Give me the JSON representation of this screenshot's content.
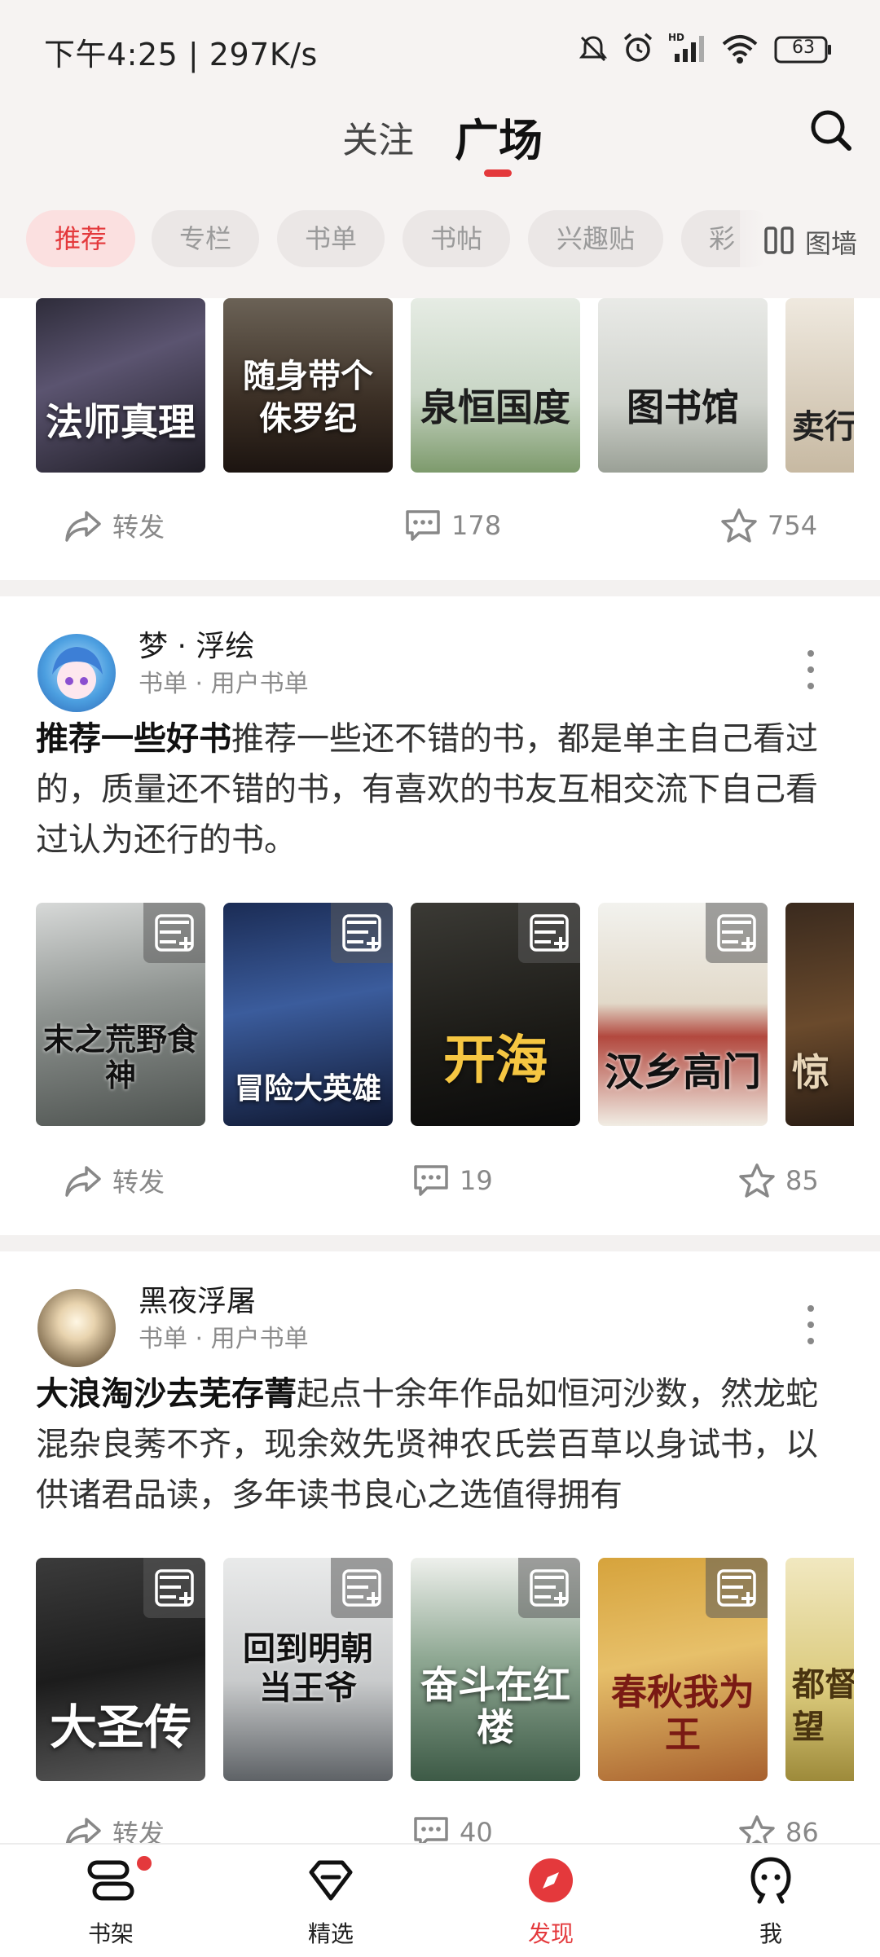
{
  "status_bar": {
    "time_speed": "下午4:25 | 297K/s",
    "battery": "63"
  },
  "header": {
    "tab_follow": "关注",
    "tab_square": "广场"
  },
  "chips": {
    "items": [
      "推荐",
      "专栏",
      "书单",
      "书帖",
      "兴趣贴",
      "彩"
    ],
    "wall_label": "图墙"
  },
  "post1": {
    "covers": [
      "法师真理",
      "随身带个侏罗纪",
      "泉恒国度",
      "图书馆",
      "卖行"
    ],
    "repost": "转发",
    "comments": "178",
    "likes": "754"
  },
  "post2": {
    "author": "梦 · 浮绘",
    "meta": "书单 · 用户书单",
    "title": "推荐一些好书",
    "body": "推荐一些还不错的书，都是单主自己看过的，质量还不错的书，有喜欢的书友互相交流下自己看过认为还行的书。",
    "covers": [
      "末之荒野食神",
      "冒险大英雄",
      "开海",
      "汉乡高门",
      "惊"
    ],
    "repost": "转发",
    "comments": "19",
    "likes": "85"
  },
  "post3": {
    "author": "黑夜浮屠",
    "meta": "书单 · 用户书单",
    "title": "大浪淘沙去芜存菁",
    "body": "起点十余年作品如恒河沙数，然龙蛇混杂良莠不齐，现余效先贤神农氏尝百草以身试书，以供诸君品读，多年读书良心之选值得拥有",
    "covers": [
      "大圣传",
      "回到明朝当王爷",
      "奋斗在红楼",
      "春秋我为王",
      "都督的野望"
    ],
    "repost": "转发",
    "comments": "40",
    "likes": "86"
  },
  "bottom_nav": [
    "书架",
    "精选",
    "发现",
    "我"
  ],
  "colors": {
    "accent": "#e4393c",
    "background": "#f6f3f2"
  }
}
